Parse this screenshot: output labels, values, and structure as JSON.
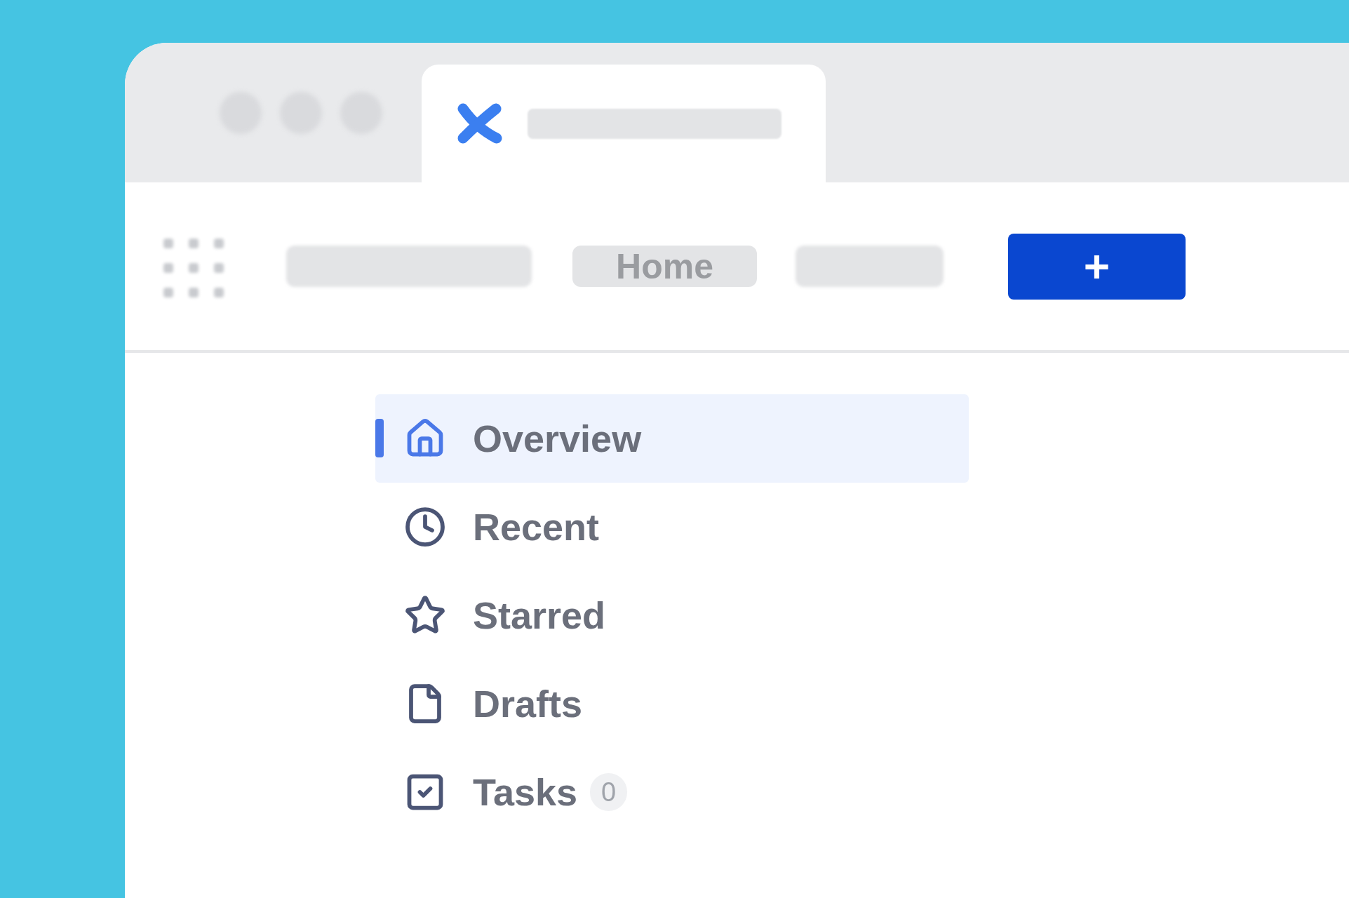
{
  "toolbar": {
    "home_label": "Home",
    "create_button": "+"
  },
  "nav": [
    {
      "label": "Overview",
      "selected": true
    },
    {
      "label": "Recent",
      "selected": false
    },
    {
      "label": "Starred",
      "selected": false
    },
    {
      "label": "Drafts",
      "selected": false
    },
    {
      "label": "Tasks",
      "selected": false,
      "badge": "0"
    }
  ]
}
